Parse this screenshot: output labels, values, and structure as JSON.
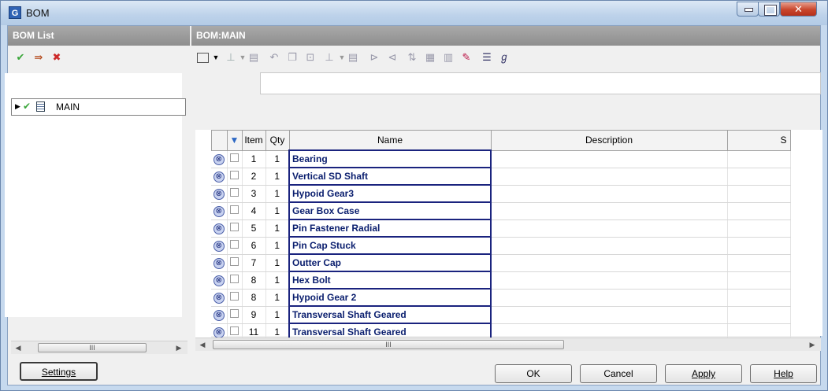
{
  "window": {
    "title": "BOM",
    "app_icon": "G"
  },
  "bom_list": {
    "header": "BOM List",
    "tree_item": "MAIN"
  },
  "bom_main": {
    "header": "BOM:MAIN",
    "columns": [
      "Item",
      "Qty",
      "Name",
      "Description",
      "S"
    ],
    "rows": [
      {
        "item": "1",
        "qty": "1",
        "name": "Bearing"
      },
      {
        "item": "2",
        "qty": "1",
        "name": "Vertical SD Shaft"
      },
      {
        "item": "3",
        "qty": "1",
        "name": "Hypoid Gear3"
      },
      {
        "item": "4",
        "qty": "1",
        "name": "Gear Box Case"
      },
      {
        "item": "5",
        "qty": "1",
        "name": "Pin Fastener Radial"
      },
      {
        "item": "6",
        "qty": "1",
        "name": "Pin Cap Stuck"
      },
      {
        "item": "7",
        "qty": "1",
        "name": "Outter Cap"
      },
      {
        "item": "8",
        "qty": "1",
        "name": "Hex Bolt"
      },
      {
        "item": "8",
        "qty": "1",
        "name": "Hypoid Gear 2"
      },
      {
        "item": "9",
        "qty": "1",
        "name": "Transversal Shaft Geared"
      },
      {
        "item": "11",
        "qty": "1",
        "name": "Transversal Shaft Geared"
      }
    ]
  },
  "buttons": {
    "settings": "Settings",
    "ok": "OK",
    "cancel": "Cancel",
    "apply": "Apply",
    "help": "Help"
  },
  "colors": {
    "accent": "#1a237e",
    "panel_header": "#8e8e8e",
    "check_green": "#3aa63a",
    "delete_red": "#cc2a2a"
  },
  "icons": {
    "left_toolbar": [
      "check-icon",
      "export-icon",
      "delete-icon"
    ],
    "right_toolbar": [
      "columns-icon",
      "dropdown-icon",
      "insert-icon",
      "dropdown-icon",
      "move-icon",
      "undo-icon",
      "copy-icon",
      "paste-icon",
      "format-icon",
      "dropdown-icon",
      "item-icon",
      "expand-icon",
      "collapse-icon",
      "sort-icon",
      "merge-icon",
      "split-icon",
      "edit-icon",
      "list-icon",
      "renumber-icon"
    ]
  }
}
